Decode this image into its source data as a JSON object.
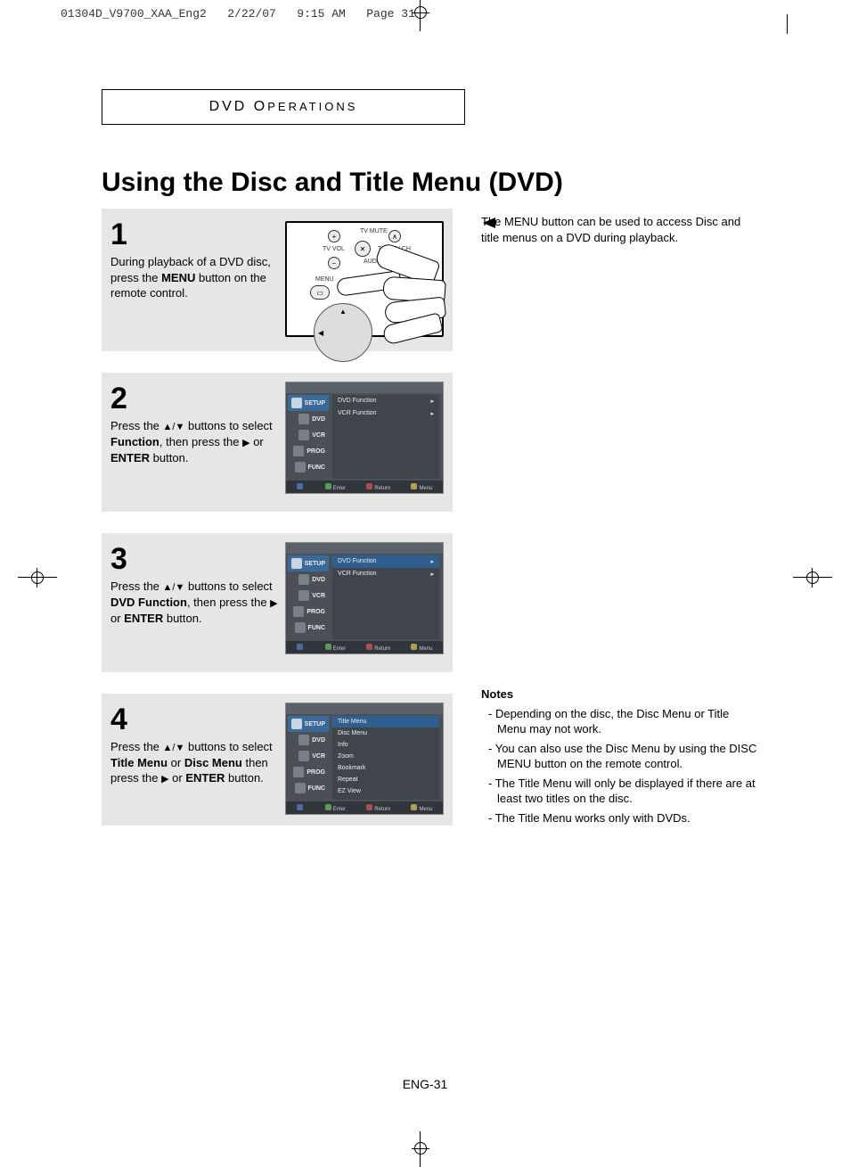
{
  "print": {
    "filename": "01304D_V9700_XAA_Eng2",
    "date": "2/22/07",
    "time": "9:15 AM",
    "page": "Page 31"
  },
  "section": {
    "main": "DVD O",
    "rest": "PERATIONS"
  },
  "title": "Using the Disc and Title Menu (DVD)",
  "callout": "The MENU button can be used to access Disc and title menus on a DVD during playback.",
  "steps": {
    "s1": {
      "num": "1",
      "t1": "During playback of a DVD disc, press the ",
      "b1": "MENU",
      "t2": " button on the remote control."
    },
    "s2": {
      "num": "2",
      "t1": "Press the ",
      "t2": " buttons to select ",
      "b1": "Function",
      "t3": ", then press the ",
      "t4": " or ",
      "b2": "ENTER",
      "t5": " button."
    },
    "s3": {
      "num": "3",
      "t1": "Press the ",
      "t2": " buttons to select ",
      "b1": "DVD Function",
      "t3": ", then press the ",
      "t4": " or ",
      "b2": "ENTER",
      "t5": " button."
    },
    "s4": {
      "num": "4",
      "t1": "Press the ",
      "t2": " buttons to select ",
      "b1": "Title Menu",
      "t3": " or ",
      "b2": "Disc Menu",
      "t4": " then press the ",
      "t5": " or ",
      "b3": "ENTER",
      "t6": " button."
    }
  },
  "remote": {
    "tv_mute": "TV MUTE",
    "tv_vol": "TV VOL",
    "trk": "TRK/TV CH",
    "audio": "AUDIO",
    "menu": "MENU"
  },
  "osd": {
    "left": [
      "SETUP",
      "DVD",
      "VCR",
      "PROG",
      "FUNC"
    ],
    "bottom": {
      "enter": "Enter",
      "return": "Return",
      "menu": "Menu"
    },
    "screen23": {
      "items": [
        "DVD Function",
        "VCR Function"
      ]
    },
    "screen4": {
      "items": [
        "Title Menu",
        "Disc Menu",
        "Info",
        "Zoom",
        "Bookmark",
        "Repeat",
        "EZ View"
      ]
    }
  },
  "notes": {
    "heading": "Notes",
    "items": [
      "Depending on the disc, the Disc Menu or Title Menu may not work.",
      "You can also use the Disc Menu by using the DISC MENU button on the remote control.",
      "The Title Menu will only be displayed if there are at least two titles on the disc.",
      "The Title Menu works only with DVDs."
    ]
  },
  "pagenum": "ENG-31"
}
